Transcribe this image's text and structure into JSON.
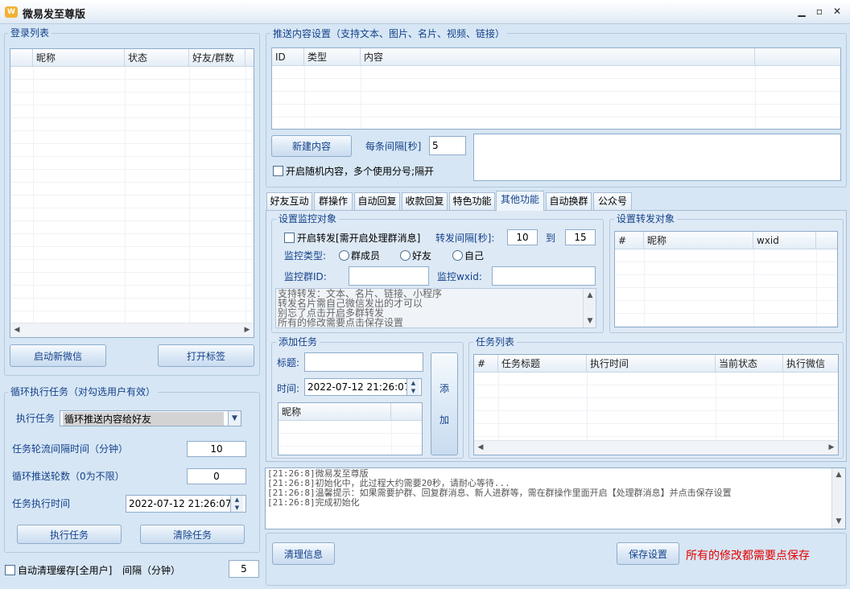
{
  "window": {
    "title": "微易发至尊版",
    "icon": "W"
  },
  "login_list": {
    "title": "登录列表",
    "columns": [
      "昵称",
      "状态",
      "好友/群数"
    ],
    "btn_start": "启动新微信",
    "btn_open": "打开标签"
  },
  "loop_task": {
    "title": "循环执行任务（对勾选用户有效）",
    "exec_label": "执行任务",
    "exec_value": "循环推送内容给好友",
    "interval_label": "任务轮流间隔时间（分钟）",
    "interval_value": "10",
    "rounds_label": "循环推送轮数（0为不限）",
    "rounds_value": "0",
    "time_label": "任务执行时间",
    "time_value": "2022-07-12 21:26:07",
    "btn_exec": "执行任务",
    "btn_clear": "清除任务"
  },
  "auto_clean": {
    "label": "自动清理缓存[全用户]",
    "interval_label": "间隔（分钟）",
    "interval_value": "5"
  },
  "push_content": {
    "title": "推送内容设置（支持文本、图片、名片、视频、链接）",
    "columns": [
      "ID",
      "类型",
      "内容"
    ],
    "btn_new": "新建内容",
    "interval_label": "每条间隔[秒]",
    "interval_value": "5",
    "random_label": "开启随机内容，多个使用分号;隔开"
  },
  "tabs": [
    "好友互动",
    "群操作",
    "自动回复",
    "收款回复",
    "特色功能",
    "其他功能",
    "自动换群",
    "公众号"
  ],
  "monitor": {
    "title": "设置监控对象",
    "forward_label": "开启转发[需开启处理群消息]",
    "fwd_interval_label": "转发间隔[秒]:",
    "fwd_min": "10",
    "to_label": "到",
    "fwd_max": "15",
    "type_label": "监控类型:",
    "type_options": [
      "群成员",
      "好友",
      "自己"
    ],
    "group_id_label": "监控群ID:",
    "wxid_label": "监控wxid:",
    "notes": [
      "支持转发：文本、名片、链接、小程序",
      "转发名片需自己微信发出的才可以",
      "别忘了点击开启多群转发",
      "所有的修改需要点击保存设置"
    ]
  },
  "forward_target": {
    "title": "设置转发对象",
    "columns": [
      "#",
      "昵称",
      "wxid"
    ]
  },
  "add_task": {
    "title": "添加任务",
    "title_label": "标题:",
    "time_label": "时间:",
    "time_value": "2022-07-12 21:26:07",
    "nick_column": "昵称",
    "btn_add_1": "添",
    "btn_add_2": "加"
  },
  "task_list": {
    "title": "任务列表",
    "columns": [
      "#",
      "任务标题",
      "执行时间",
      "当前状态",
      "执行微信"
    ]
  },
  "log_lines": [
    "[21:26:8]微易发至尊版",
    "[21:26:8]初始化中，此过程大约需要20秒，请耐心等待...",
    "[21:26:8]温馨提示：如果需要护群、回复群消息、新人进群等，需在群操作里面开启【处理群消息】并点击保存设置",
    "[21:26:8]完成初始化"
  ],
  "bottom": {
    "btn_clear_info": "清理信息",
    "btn_save": "保存设置",
    "save_hint": "所有的修改都需要点保存"
  },
  "colors": {
    "accent": "#15428b",
    "warning": "#e60000",
    "background": "#d6e6f4"
  }
}
